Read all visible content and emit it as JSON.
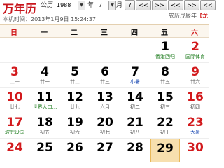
{
  "header": {
    "logo": "万年历",
    "calendar_type_label": "公历",
    "year_value": "1988",
    "year_label": "年",
    "month_value": "7",
    "month_label": "月",
    "nav_buttons": [
      "?",
      "<<",
      ">>",
      "<<",
      ">>",
      "<<"
    ],
    "now_time_label": "本机时间：",
    "now_time_value": "2013年1月9日 15:24:37",
    "almanac_label": "农历戊辰年",
    "almanac_year": "【龙"
  },
  "weekdays": [
    "日",
    "一",
    "二",
    "三",
    "四",
    "五",
    "六"
  ],
  "weeks": [
    [
      null,
      null,
      null,
      null,
      null,
      {
        "day": "1",
        "note": "香港回归",
        "note_type": "green"
      },
      {
        "day": "2",
        "note": "国际体育",
        "note_type": "green",
        "red": true
      }
    ],
    [
      {
        "day": "3",
        "note": "二十",
        "red": true
      },
      {
        "day": "4",
        "note": "廿一"
      },
      {
        "day": "5",
        "note": "廿二"
      },
      {
        "day": "6",
        "note": "廿三"
      },
      {
        "day": "7",
        "note": "小暑",
        "note_type": "blue"
      },
      {
        "day": "8",
        "note": "廿五"
      },
      {
        "day": "9",
        "note": "廿六",
        "red": true
      }
    ],
    [
      {
        "day": "10",
        "note": "廿七",
        "red": true
      },
      {
        "day": "11",
        "note": "世界人口...",
        "note_type": "green"
      },
      {
        "day": "12",
        "note": "廿九"
      },
      {
        "day": "13",
        "note": "六月"
      },
      {
        "day": "14",
        "note": "初二"
      },
      {
        "day": "15",
        "note": "初三"
      },
      {
        "day": "16",
        "note": "初四",
        "red": true
      }
    ],
    [
      {
        "day": "17",
        "note": "玻兜设国",
        "note_type": "green",
        "red": true
      },
      {
        "day": "18",
        "note": "初五"
      },
      {
        "day": "19",
        "note": "初六"
      },
      {
        "day": "20",
        "note": "初七"
      },
      {
        "day": "21",
        "note": "初八"
      },
      {
        "day": "22",
        "note": "初十"
      },
      {
        "day": "23",
        "note": "大暑",
        "note_type": "blue",
        "red": true
      }
    ],
    [
      {
        "day": "24",
        "red": true
      },
      {
        "day": "25"
      },
      {
        "day": "26"
      },
      {
        "day": "27"
      },
      {
        "day": "28"
      },
      {
        "day": "29",
        "today": true
      },
      {
        "day": "30",
        "red": true
      }
    ]
  ]
}
